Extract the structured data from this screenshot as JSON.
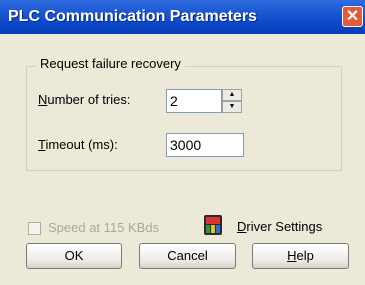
{
  "window": {
    "title": "PLC Communication Parameters",
    "close_glyph": "✕"
  },
  "recovery": {
    "group_label": "Request failure recovery",
    "tries_label_hotkey": "N",
    "tries_label_rest": "umber of tries:",
    "tries_value": "2",
    "timeout_label_hotkey": "T",
    "timeout_label_rest": "imeout (ms):",
    "timeout_value": "3000"
  },
  "speed": {
    "label": "Speed at 115 KBds",
    "checked": false,
    "enabled": false
  },
  "driver": {
    "hotkey": "D",
    "label_rest": "river Settings",
    "icon": "driver-settings-icon"
  },
  "buttons": {
    "ok": "OK",
    "cancel": "Cancel",
    "help_hotkey": "H",
    "help_rest": "elp"
  },
  "colors": {
    "titlebar": "#0a46c9",
    "face": "#ece9d8",
    "close": "#e35b3a"
  }
}
